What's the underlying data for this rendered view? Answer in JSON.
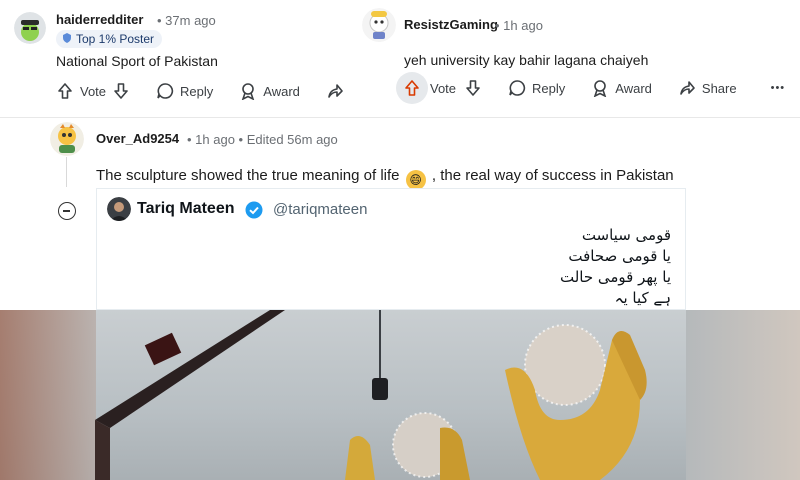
{
  "comment_left": {
    "username": "haiderredditer",
    "time": "37m ago",
    "flair": "Top 1% Poster",
    "body": "National Sport of Pakistan",
    "actions": {
      "vote": "Vote",
      "reply": "Reply",
      "award": "Award"
    }
  },
  "comment_right": {
    "username": "ResistzGaming",
    "time": "1h ago",
    "body": "yeh university kay bahir lagana chaiyeh",
    "actions": {
      "vote": "Vote",
      "reply": "Reply",
      "award": "Award",
      "share": "Share",
      "more": "•••"
    }
  },
  "comment_main": {
    "username": "Over_Ad9254",
    "meta": "1h ago • Edited 56m ago",
    "body": "The sculpture showed the true meaning of life",
    "emoji": "😄",
    "body_tail": ", the real way of success in Pakistan"
  },
  "tweet": {
    "name": "Tariq Mateen",
    "handle": "@tariqmateen",
    "lines": [
      "قومی سیاست",
      "یا قومی صحافت",
      "یا پھر قومی حالت",
      "ہے کیا یہ"
    ]
  },
  "colors": {
    "accent": "#d93a00",
    "verified": "#1d9bf0",
    "meta": "#6b6f74"
  }
}
